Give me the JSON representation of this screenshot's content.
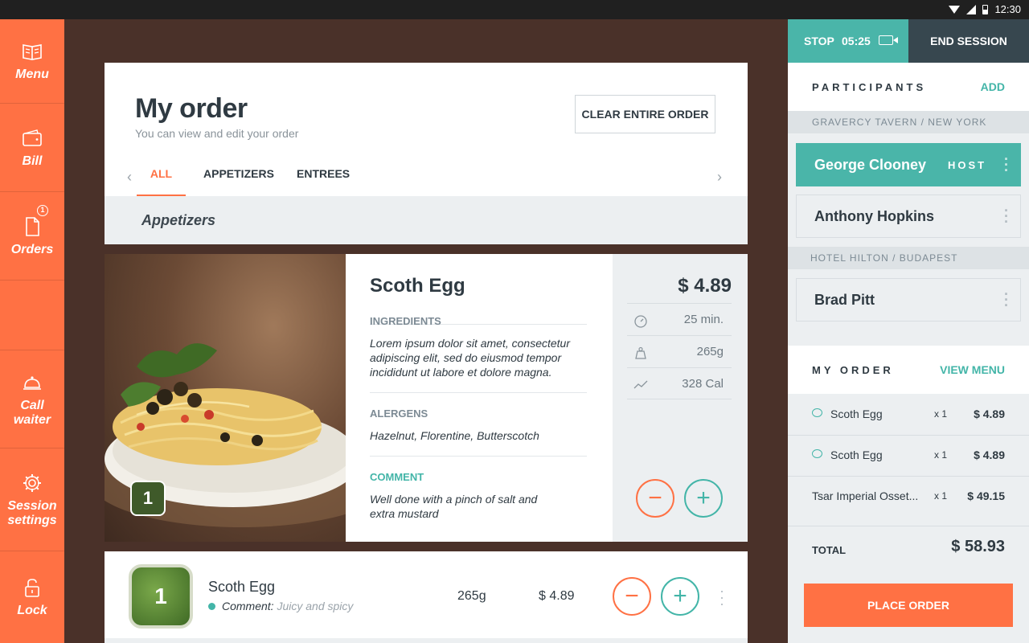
{
  "status_bar": {
    "time": "12:30"
  },
  "sidebar": {
    "items": [
      {
        "label": "Menu",
        "icon": "book-icon"
      },
      {
        "label": "Bill",
        "icon": "wallet-icon"
      },
      {
        "label": "Orders",
        "icon": "document-icon",
        "badge": "1"
      },
      {
        "label": "Call\nwaiter",
        "icon": "bell-icon"
      },
      {
        "label": "Session\nsettings",
        "icon": "gear-icon"
      },
      {
        "label": "Lock",
        "icon": "lock-icon"
      }
    ]
  },
  "header": {
    "title": "My order",
    "subtitle": "You can view and edit your order",
    "clear_label": "CLEAR ENTIRE ORDER",
    "tabs": [
      "ALL",
      "APPETIZERS",
      "ENTREES"
    ],
    "active_tab": "ALL"
  },
  "section": {
    "title": "Appetizers"
  },
  "detail": {
    "name": "Scoth Egg",
    "quantity": "1",
    "ingredients_label": "INGREDIENTS",
    "ingredients": "Lorem ipsum dolor sit amet, consectetur adipiscing elit, sed do eiusmod tempor incididunt ut labore et dolore magna.",
    "allergens_label": "ALERGENS",
    "allergens": "Hazelnut, Florentine, Butterscotch",
    "comment_label": "COMMENT",
    "comment": "Well done with a pinch of salt and extra mustard",
    "price": "$ 4.89",
    "stats": {
      "time": "25 min.",
      "weight": "265g",
      "calories": "328 Cal"
    },
    "minus_symbol": "−",
    "plus_symbol": "+"
  },
  "row": {
    "quantity": "1",
    "name": "Scoth Egg",
    "comment_label": "Comment:",
    "comment": "Juicy and spicy",
    "weight": "265g",
    "price": "$ 4.89",
    "minus_symbol": "−",
    "plus_symbol": "+"
  },
  "session": {
    "stop_label": "STOP",
    "timer": "05:25",
    "end_label": "END SESSION"
  },
  "participants": {
    "title": "PARTICIPANTS",
    "add_label": "ADD",
    "venues": [
      {
        "name": "GRAVERCY TAVERN / NEW YORK"
      },
      {
        "name": "HOTEL HILTON / BUDAPEST"
      }
    ],
    "people": [
      {
        "name": "George Clooney",
        "role": "HOST"
      },
      {
        "name": "Anthony Hopkins"
      },
      {
        "name": "Brad Pitt"
      }
    ]
  },
  "my_order": {
    "title": "MY ORDER",
    "view_menu_label": "VIEW MENU",
    "items": [
      {
        "name": "Scoth Egg",
        "qty": "x 1",
        "price": "$ 4.89"
      },
      {
        "name": "Scoth Egg",
        "qty": "x 1",
        "price": "$ 4.89"
      },
      {
        "name": "Tsar Imperial Osset...",
        "qty": "x 1",
        "price": "$ 49.15"
      }
    ],
    "total_label": "TOTAL",
    "total": "$ 58.93",
    "place_label": "PLACE ORDER"
  },
  "colors": {
    "accent": "#ff7144",
    "teal": "#4ab5a9",
    "dark": "#37474f",
    "background": "#4a3129"
  }
}
